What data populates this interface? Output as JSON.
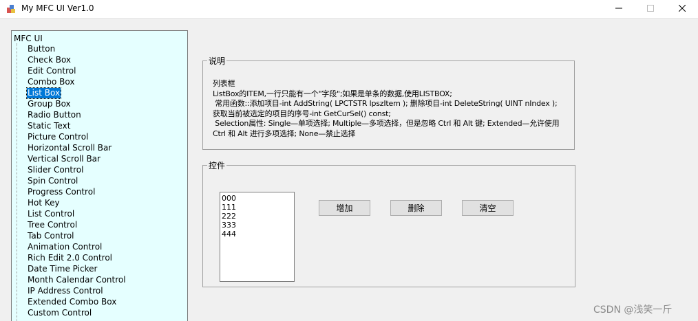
{
  "window": {
    "title": "My MFC UI Ver1.0",
    "icons": {
      "app": "mfc-app-icon",
      "minimize": "minimize-icon",
      "maximize": "maximize-icon",
      "close": "close-icon"
    }
  },
  "tree": {
    "root": "MFC UI",
    "items": [
      "Button",
      "Check Box",
      "Edit Control",
      "Combo Box",
      "List Box",
      "Group Box",
      "Radio Button",
      "Static Text",
      "Picture Control",
      "Horizontal Scroll Bar",
      "Vertical Scroll Bar",
      "Slider Control",
      "Spin Control",
      "Progress Control",
      "Hot Key",
      "List Control",
      "Tree Control",
      "Tab Control",
      "Animation Control",
      "Rich Edit 2.0 Control",
      "Date Time Picker",
      "Month Calendar Control",
      "IP Address Control",
      "Extended Combo Box",
      "Custom Control"
    ],
    "selected": "List Box"
  },
  "description": {
    "legend": "说明",
    "text": "列表框\nListBox的ITEM,一行只能有一个\"字段\";如果是单条的数据,使用LISTBOX;\n 常用函数::添加项目-int AddString( LPCTSTR lpszItem ); 删除项目-int DeleteString( UINT nIndex ); 获取当前被选定的项目的序号-int GetCurSel() const;\n Selection属性: Single—单项选择; Multiple—多项选择，但是忽略 Ctrl 和 Alt 键; Extended—允许使用 Ctrl 和 Alt 进行多项选择; None—禁止选择"
  },
  "controls": {
    "legend": "控件",
    "listbox_items": [
      "000",
      "111",
      "222",
      "333",
      "444"
    ],
    "buttons": {
      "add": "增加",
      "delete": "删除",
      "clear": "清空"
    }
  },
  "watermark": "CSDN @浅笑一斤",
  "colors": {
    "tree_bg": "#e5ffff",
    "selection": "#0078d7"
  }
}
